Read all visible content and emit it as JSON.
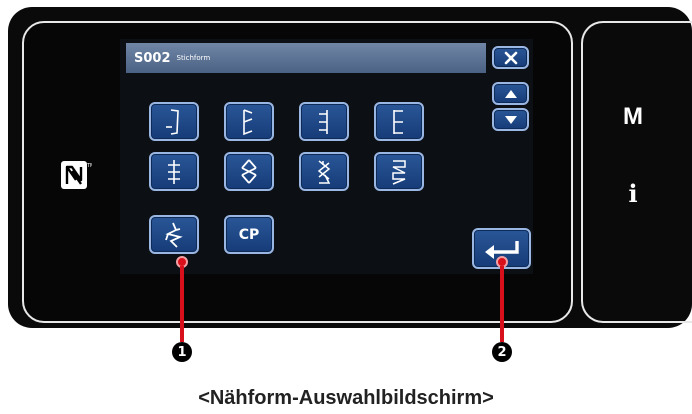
{
  "dialog": {
    "code": "S002",
    "title": "Stichform"
  },
  "icons": {
    "nfc": "nfc-n-mark-icon",
    "close": "close-x-icon",
    "up": "up-triangle-icon",
    "down": "down-triangle-icon",
    "enter": "enter-return-icon"
  },
  "stitch_buttons": [
    {
      "icon": "stitch-icon-1"
    },
    {
      "icon": "stitch-icon-2"
    },
    {
      "icon": "stitch-icon-3"
    },
    {
      "icon": "stitch-icon-4"
    },
    {
      "icon": "stitch-icon-5"
    },
    {
      "icon": "stitch-icon-6"
    },
    {
      "icon": "stitch-icon-7"
    },
    {
      "icon": "stitch-icon-8"
    },
    {
      "icon": "stitch-icon-9"
    }
  ],
  "cp_button": {
    "label": "CP"
  },
  "side_keys": {
    "m_label": "M",
    "i_label": "i"
  },
  "callouts": {
    "first": "1",
    "second": "2"
  },
  "caption": "<Nähform-Auswahlbildschirm>",
  "colors": {
    "button_fill": "#1f4a8a",
    "button_border": "#9ab6e2",
    "title_bar": "#5a7195",
    "callout_red": "#d8101c"
  }
}
